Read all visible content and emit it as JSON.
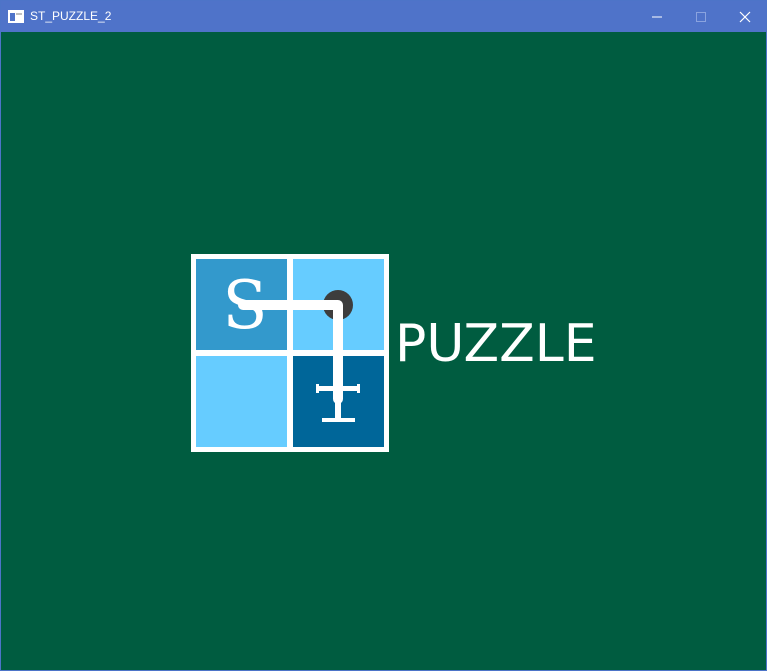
{
  "window": {
    "title": "ST_PUZZLE_2",
    "controls": {
      "minimize": "minimize",
      "maximize": "maximize",
      "close": "close"
    }
  },
  "splash": {
    "logo_letters": [
      "S",
      "T"
    ],
    "puzzle_label": "PUZZLE"
  },
  "colors": {
    "background": "#005c40",
    "titlebar": "#4f73c9",
    "tile_light": "#66ccff",
    "tile_medium": "#3399cc",
    "tile_dark": "#006699",
    "grid_border": "#ffffff"
  },
  "icons": [
    "app-window-icon",
    "minimize-icon",
    "maximize-icon",
    "close-icon"
  ]
}
